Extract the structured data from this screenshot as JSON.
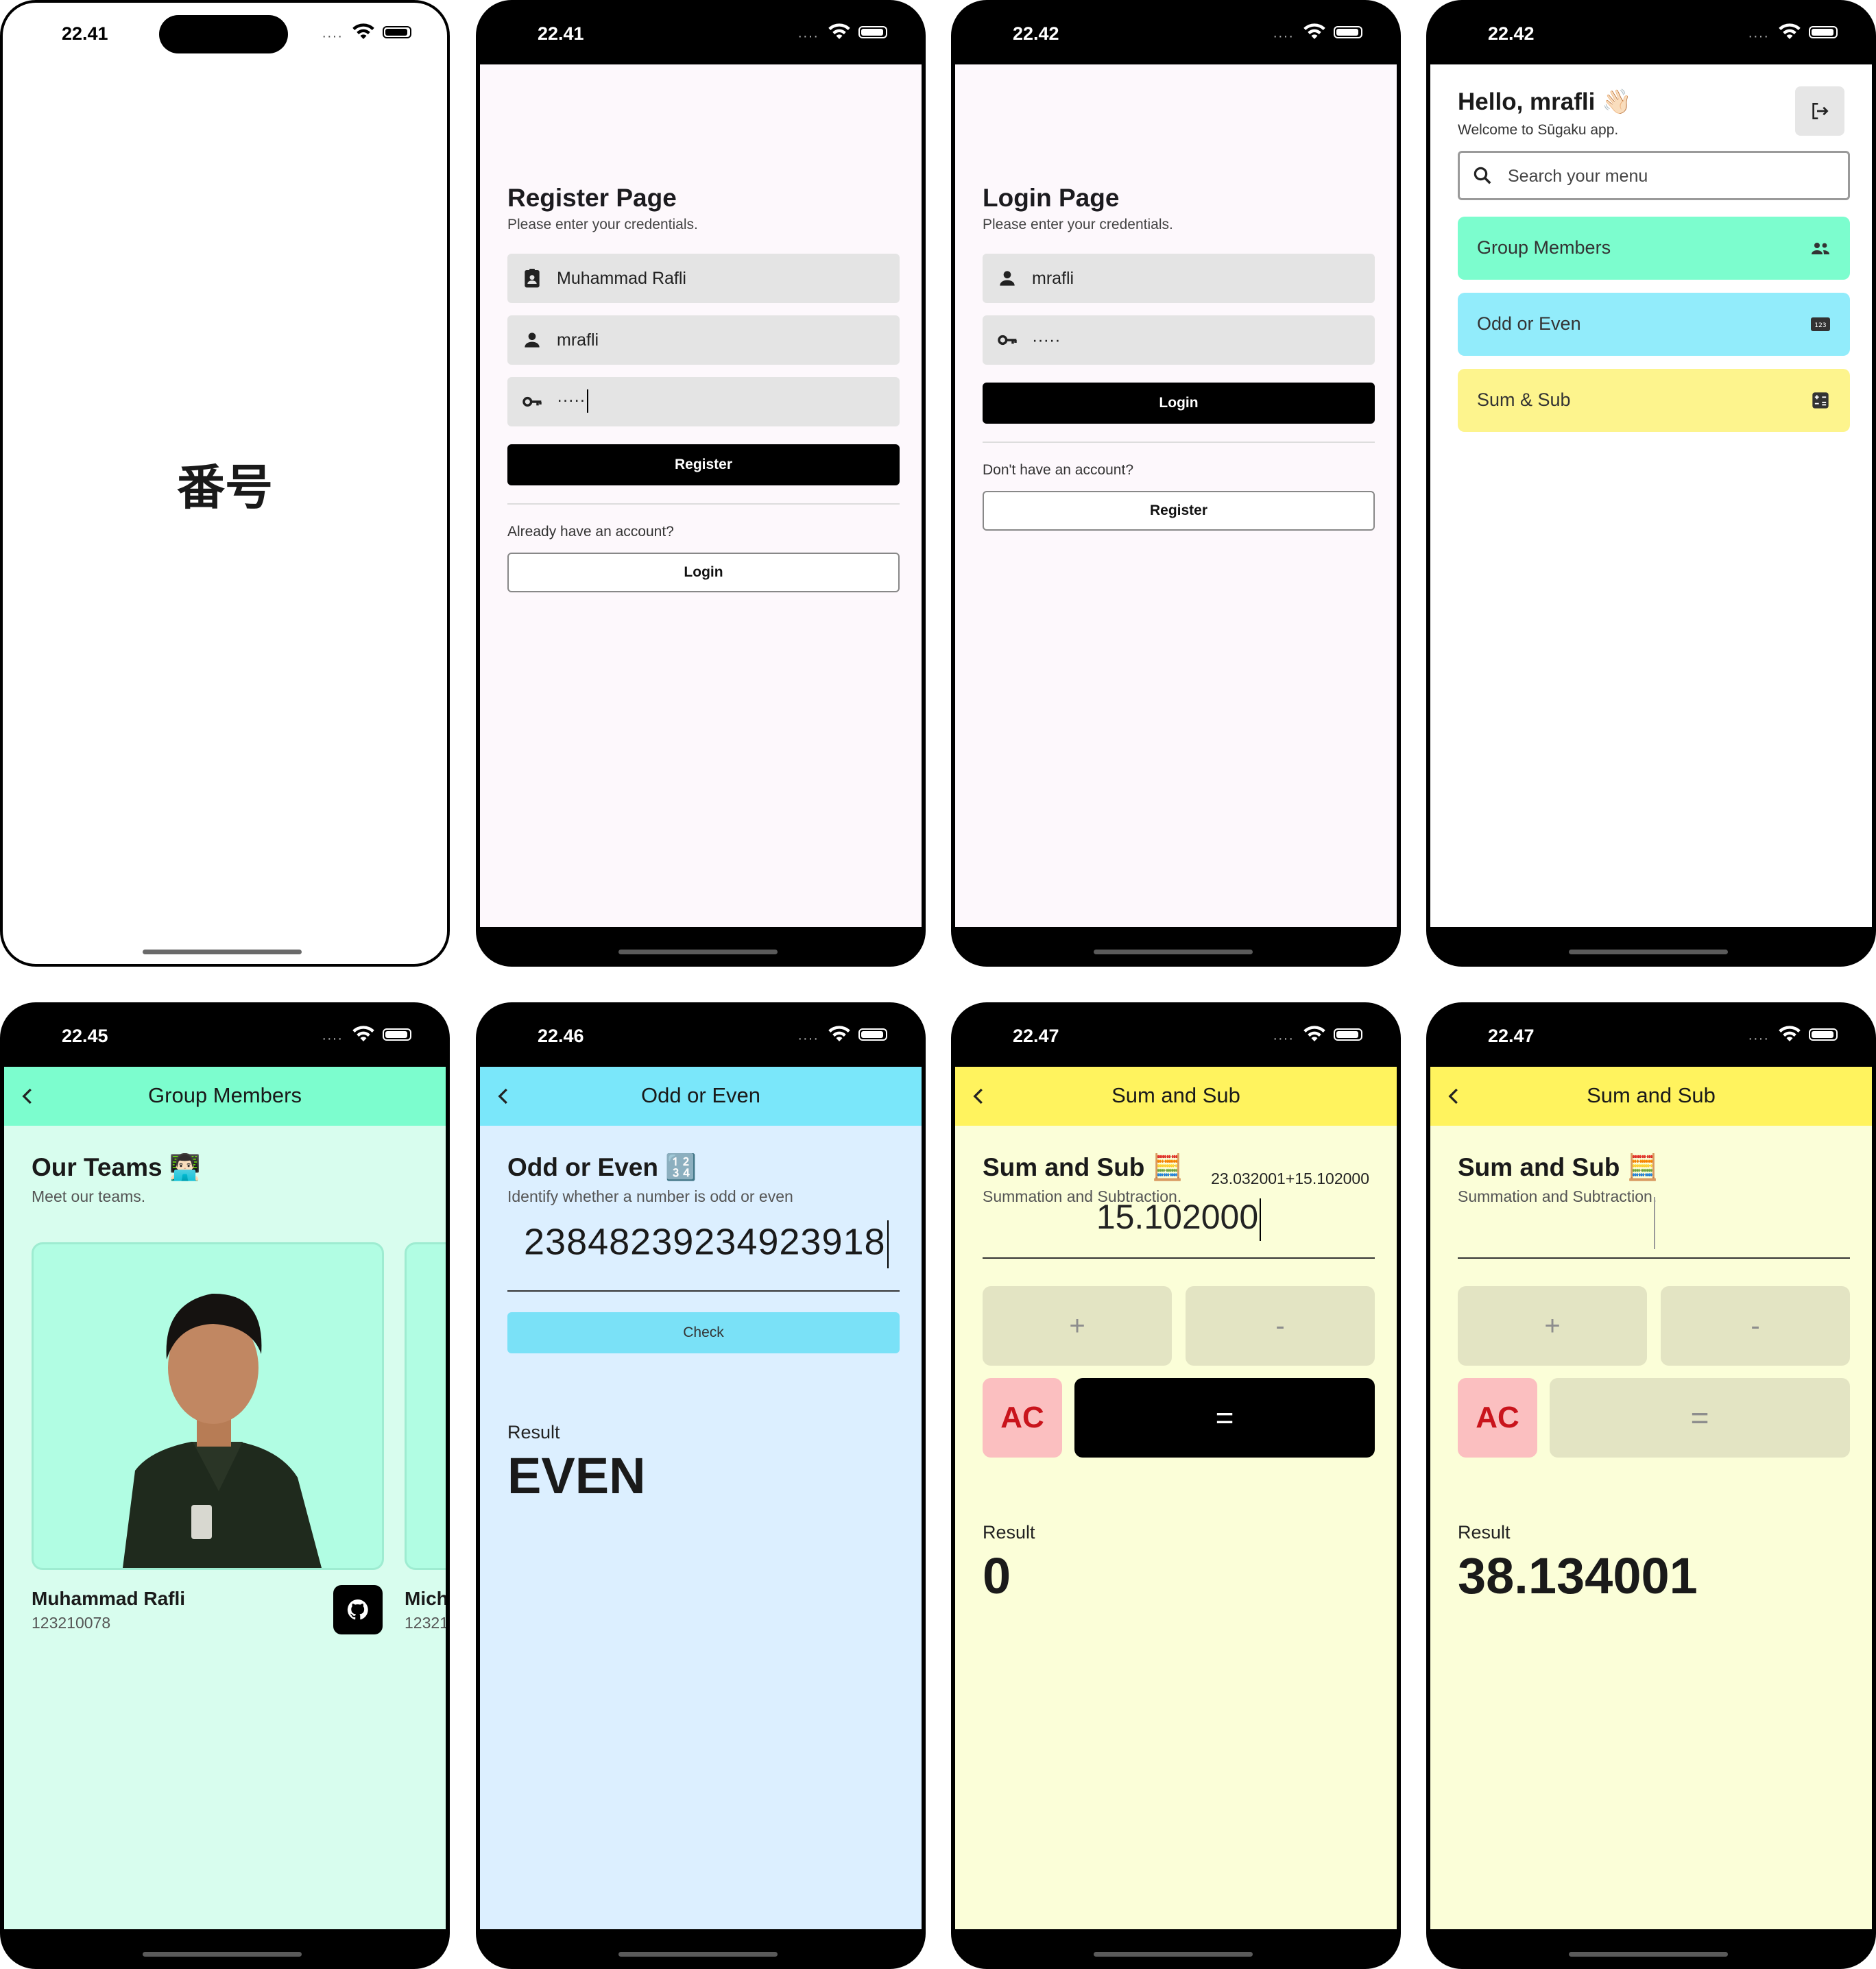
{
  "status_times": [
    "22.41",
    "22.41",
    "22.42",
    "22.42",
    "22.45",
    "22.46",
    "22.47",
    "22.47"
  ],
  "status_dots": "····",
  "splash": {
    "logo": "番号"
  },
  "register": {
    "title": "Register Page",
    "subtitle": "Please enter your credentials.",
    "name_value": "Muhammad Rafli",
    "username_value": "mrafli",
    "password_value": "·····",
    "register_label": "Register",
    "hint": "Already have an account?",
    "login_label": "Login"
  },
  "login": {
    "title": "Login Page",
    "subtitle": "Please enter your credentials.",
    "username_value": "mrafli",
    "password_value": "·····",
    "login_label": "Login",
    "hint": "Don't have an account?",
    "register_label": "Register"
  },
  "home": {
    "greeting": "Hello, mrafli 👋🏻",
    "welcome": "Welcome to Sūgaku app.",
    "search_placeholder": "Search your menu",
    "menu": [
      {
        "label": "Group Members",
        "color": "#7cfdce",
        "icon": "group-icon"
      },
      {
        "label": "Odd or Even",
        "color": "#92ecfb",
        "icon": "numbers-icon"
      },
      {
        "label": "Sum & Sub",
        "color": "#fdf48d",
        "icon": "calculator-icon"
      }
    ]
  },
  "group": {
    "appbar_title": "Group Members",
    "title": "Our Teams 👨🏻‍💻",
    "subtitle": "Meet our teams.",
    "members": [
      {
        "name": "Muhammad Rafli",
        "nim": "123210078"
      },
      {
        "name": "Mich",
        "nim": "12321"
      }
    ],
    "colors": {
      "appbar": "#7cfdce",
      "bg": "#d8fdee"
    }
  },
  "oddeven": {
    "appbar_title": "Odd or Even",
    "title": "Odd or Even 🔢",
    "subtitle": "Identify whether a number is odd or even",
    "input_value": "23848239234923918",
    "check_label": "Check",
    "result_label": "Result",
    "result_value": "EVEN",
    "colors": {
      "appbar": "#7ae7fa",
      "bg": "#dcefff"
    }
  },
  "sumsub1": {
    "appbar_title": "Sum and Sub",
    "title": "Sum and Sub 🧮",
    "subtitle": "Summation and Subtraction.",
    "expression": "23.032001+15.102000",
    "input_value": "15.102000",
    "plus_label": "+",
    "minus_label": "-",
    "ac_label": "AC",
    "eq_label": "=",
    "result_label": "Result",
    "result_value": "0"
  },
  "sumsub2": {
    "appbar_title": "Sum and Sub",
    "title": "Sum and Sub 🧮",
    "subtitle": "Summation and Subtraction.",
    "expression": "",
    "input_value": "",
    "plus_label": "+",
    "minus_label": "-",
    "ac_label": "AC",
    "eq_label": "=",
    "result_label": "Result",
    "result_value": "38.134001"
  },
  "sumsub_colors": {
    "appbar": "#fff35e",
    "bg": "#fbfed8"
  }
}
